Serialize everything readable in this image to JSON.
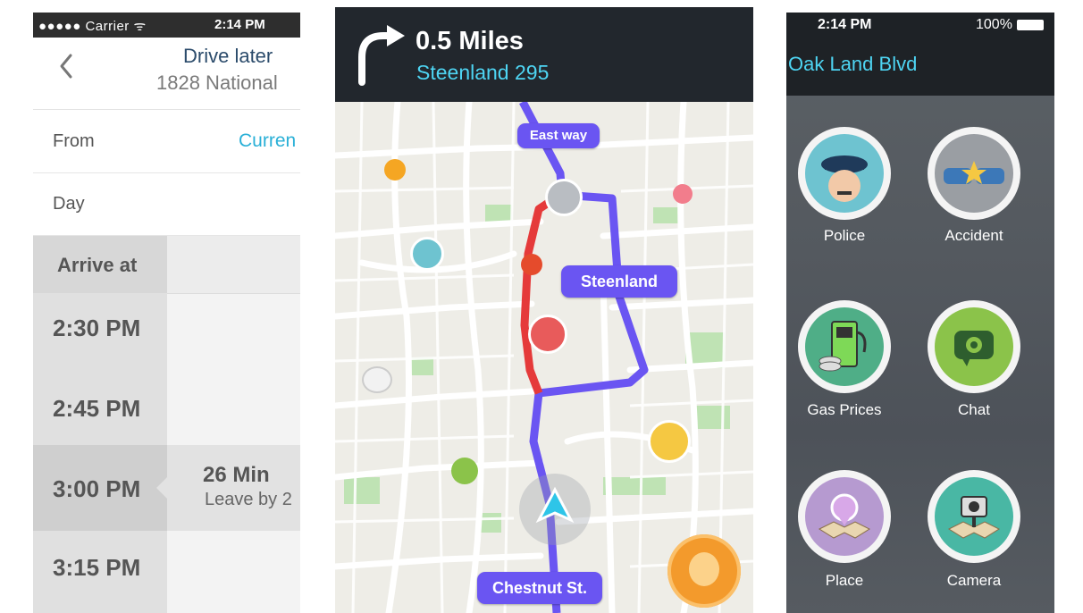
{
  "screen1": {
    "status": {
      "carrier": "●●●●● Carrier ᯤ",
      "time": "2:14 PM"
    },
    "nav": {
      "back_icon": "chevron-left-icon",
      "title": "Drive later",
      "subtitle": "1828 National"
    },
    "from": {
      "label": "From",
      "value": "Curren"
    },
    "day": {
      "label": "Day"
    },
    "arrive_label": "Arrive at",
    "times": [
      "2:30 PM",
      "2:45 PM",
      "3:00 PM",
      "3:15 PM"
    ],
    "selected_time": "3:00 PM",
    "duration": "26 Min",
    "leave_by": "Leave by 2"
  },
  "screen2": {
    "distance": "0.5 Miles",
    "next_street": "Steenland 295",
    "turn_icon": "turn-right-arrow-icon",
    "labels": {
      "east_way": "East way",
      "steenland": "Steenland",
      "chestnut": "Chestnut St."
    },
    "colors": {
      "route": "#6a55f2",
      "traffic": "#e53a3a",
      "header": "#22272d",
      "accent": "#4ed5f3"
    }
  },
  "screen3": {
    "status": {
      "time": "2:14 PM",
      "battery": "100%"
    },
    "street": "Oak Land Blvd",
    "items": [
      {
        "label": "Police",
        "icon": "police-icon",
        "color": "#6ec3d0"
      },
      {
        "label": "Accident",
        "icon": "accident-icon",
        "color": "#9a9ea3"
      },
      {
        "label": "Gas Prices",
        "icon": "gas-pump-icon",
        "color": "#4fae87"
      },
      {
        "label": "Chat",
        "icon": "chat-camera-icon",
        "color": "#8bc34a"
      },
      {
        "label": "Place",
        "icon": "place-icon",
        "color": "#b69ad0"
      },
      {
        "label": "Camera",
        "icon": "camera-icon",
        "color": "#49b7a4"
      }
    ]
  }
}
